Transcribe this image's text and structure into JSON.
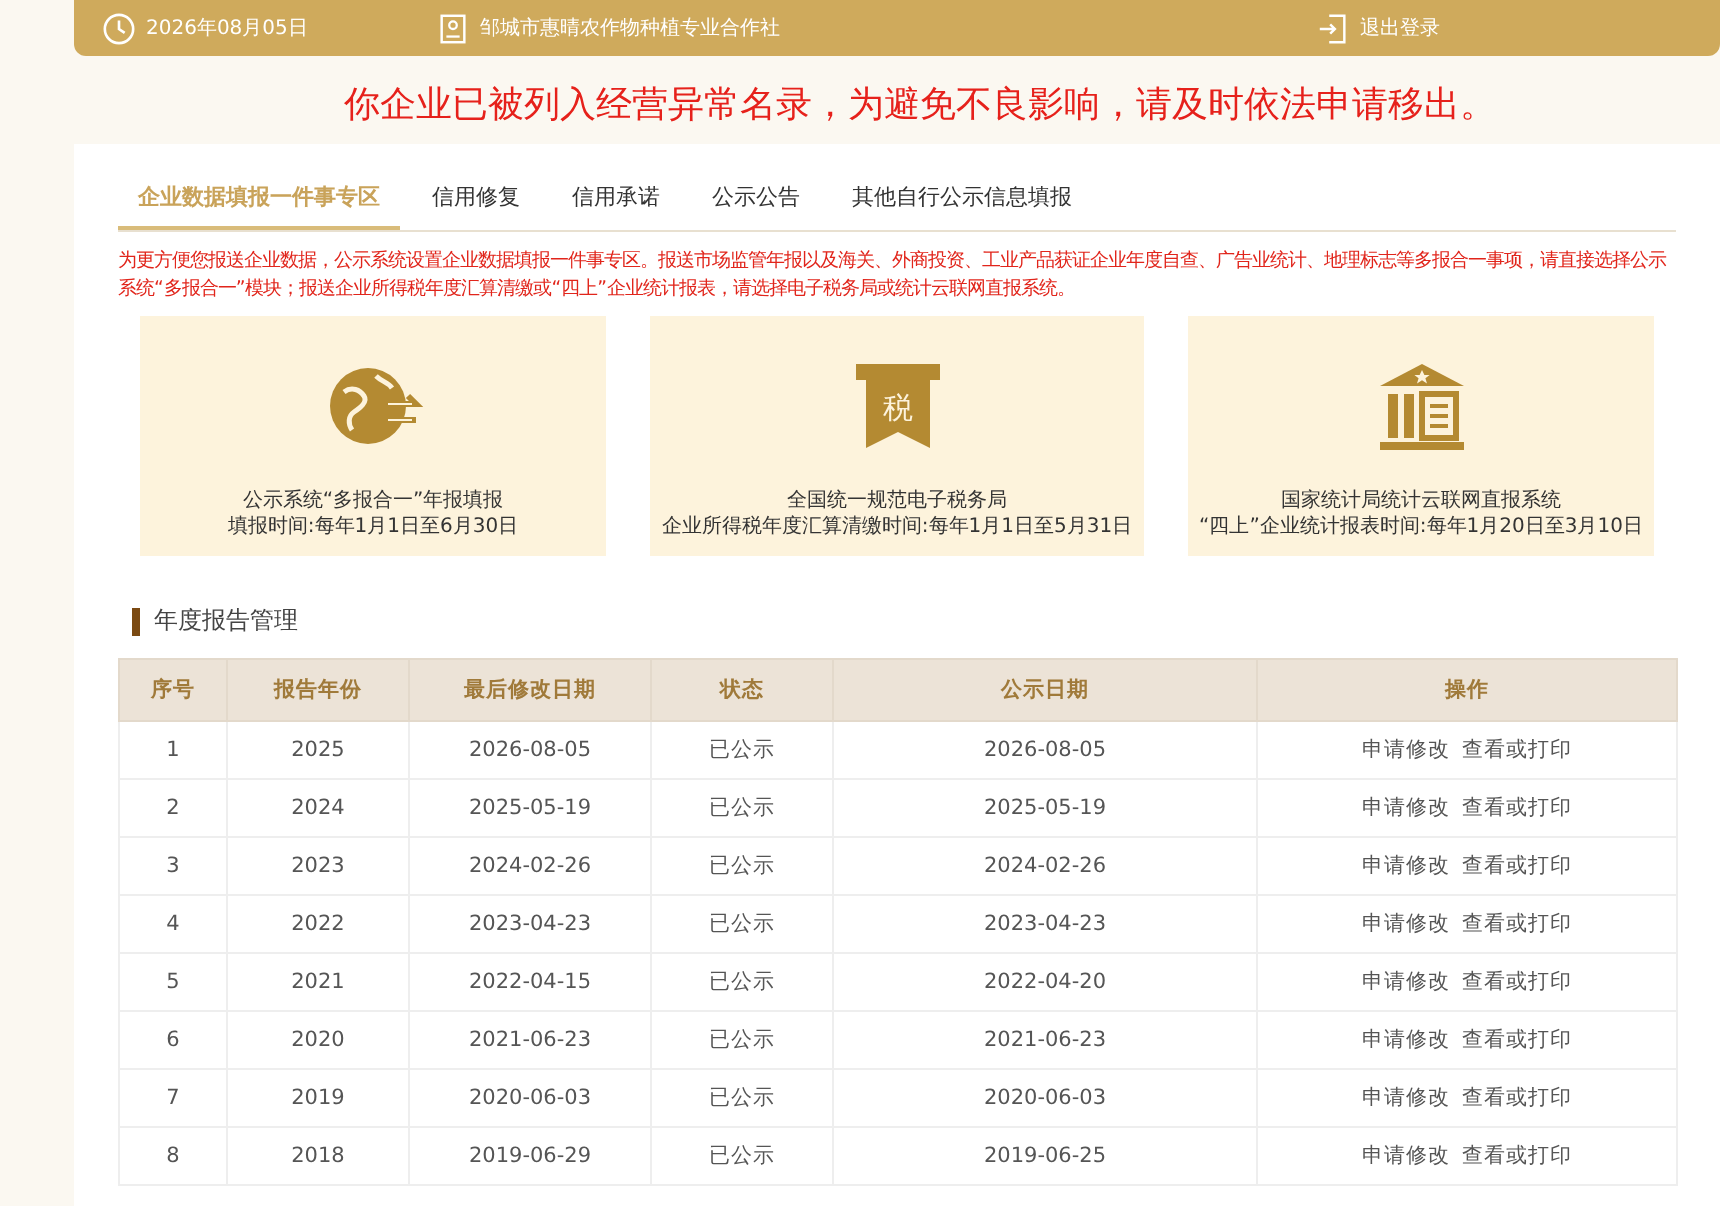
{
  "header": {
    "date": "2026年08月05日",
    "company": "邹城市惠晴农作物种植专业合作社",
    "logout": "退出登录"
  },
  "notice": "你企业已被列入经营异常名录，为避免不良影响，请及时依法申请移出。",
  "tabs": [
    {
      "label": "企业数据填报一件事专区",
      "selected": true
    },
    {
      "label": "信用修复",
      "selected": false
    },
    {
      "label": "信用承诺",
      "selected": false
    },
    {
      "label": "公示公告",
      "selected": false
    },
    {
      "label": "其他自行公示信息填报",
      "selected": false
    }
  ],
  "intro": "为更方便您报送企业数据，公示系统设置企业数据填报一件事专区。报送市场监管年报以及海关、外商投资、工业产品获证企业年度自查、广告业统计、地理标志等多报合一事项，请直接选择公示系统“多报合一”模块；报送企业所得税年度汇算清缴或“四上”企业统计报表，请选择电子税务局或统计云联网直报系统。",
  "cards": [
    {
      "kind": "globe",
      "title": "公示系统“多报合一”年报填报",
      "period": "填报时间:每年1月1日至6月30日"
    },
    {
      "kind": "tax",
      "icon_text": "税",
      "title": "全国统一规范电子税务局",
      "period": "企业所得税年度汇算清缴时间:每年1月1日至5月31日"
    },
    {
      "kind": "bank",
      "title": "国家统计局统计云联网直报系统",
      "period": "“四上”企业统计报表时间:每年1月20日至3月10日"
    }
  ],
  "section_title": "年度报告管理",
  "table": {
    "columns": [
      "序号",
      "报告年份",
      "最后修改日期",
      "状态",
      "公示日期",
      "操作"
    ],
    "rows": [
      {
        "no": "1",
        "year": "2025",
        "modified": "2026-08-05",
        "status": "已公示",
        "published": "2026-08-05",
        "actions": [
          "申请修改",
          "查看或打印"
        ]
      },
      {
        "no": "2",
        "year": "2024",
        "modified": "2025-05-19",
        "status": "已公示",
        "published": "2025-05-19",
        "actions": [
          "申请修改",
          "查看或打印"
        ]
      },
      {
        "no": "3",
        "year": "2023",
        "modified": "2024-02-26",
        "status": "已公示",
        "published": "2024-02-26",
        "actions": [
          "申请修改",
          "查看或打印"
        ]
      },
      {
        "no": "4",
        "year": "2022",
        "modified": "2023-04-23",
        "status": "已公示",
        "published": "2023-04-23",
        "actions": [
          "申请修改",
          "查看或打印"
        ]
      },
      {
        "no": "5",
        "year": "2021",
        "modified": "2022-04-15",
        "status": "已公示",
        "published": "2022-04-20",
        "actions": [
          "申请修改",
          "查看或打印"
        ]
      },
      {
        "no": "6",
        "year": "2020",
        "modified": "2021-06-23",
        "status": "已公示",
        "published": "2021-06-23",
        "actions": [
          "申请修改",
          "查看或打印"
        ]
      },
      {
        "no": "7",
        "year": "2019",
        "modified": "2020-06-03",
        "status": "已公示",
        "published": "2020-06-03",
        "actions": [
          "申请修改",
          "查看或打印"
        ]
      },
      {
        "no": "8",
        "year": "2018",
        "modified": "2019-06-29",
        "status": "已公示",
        "published": "2019-06-25",
        "actions": [
          "申请修改",
          "查看或打印"
        ]
      }
    ]
  }
}
